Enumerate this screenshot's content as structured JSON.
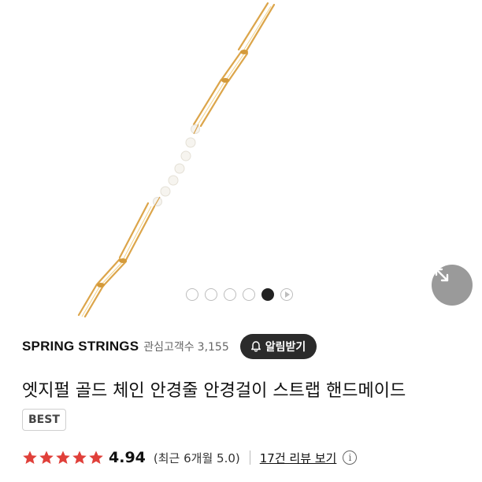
{
  "product": {
    "brand": "SPRING STRINGS",
    "followers_label": "관심고객수",
    "followers_count": "3,155",
    "alert_button": "알림받기",
    "title": "엣지펄 골드 체인 안경줄 안경걸이 스트랩 핸드메이드",
    "badge": "BEST"
  },
  "gallery": {
    "total_slides": 6,
    "active_index": 4,
    "last_is_video": true
  },
  "rating": {
    "score": "4.94",
    "stars": 5,
    "recent": "(최근 6개월 5.0)",
    "reviews_link": "17건 리뷰 보기",
    "info_icon": "i"
  },
  "colors": {
    "gold": "#e0a640",
    "star_red": "#e0403a",
    "dark_button": "#2b2b2b"
  },
  "icons": {
    "expand": "expand-arrows-icon",
    "bell": "bell-icon",
    "info": "info-icon",
    "video": "play-icon"
  }
}
